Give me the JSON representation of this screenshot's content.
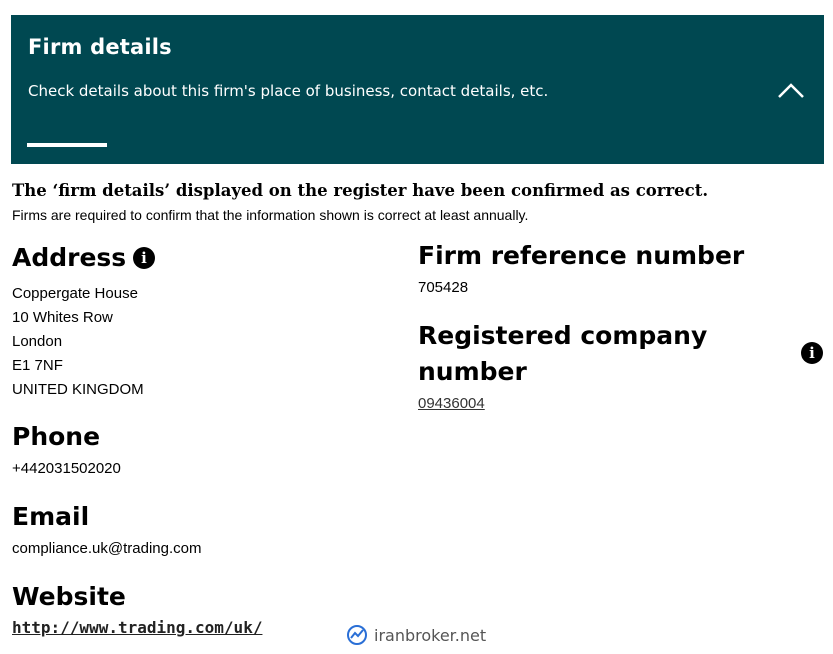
{
  "banner": {
    "title": "Firm details",
    "description": "Check details about this firm's place of business, contact details, etc.",
    "toggle_icon": "chevron-up-icon",
    "background_color": "#004851"
  },
  "confirmation": {
    "heading": "The ‘firm details’ displayed on the register have been confirmed as correct.",
    "subtext": "Firms are required to confirm that the information shown is correct at least annually."
  },
  "address": {
    "title": "Address",
    "info_icon": "info-icon",
    "lines": [
      "Coppergate House",
      "10 Whites Row",
      "London",
      "E1 7NF",
      "UNITED KINGDOM"
    ]
  },
  "phone": {
    "title": "Phone",
    "value": "+442031502020"
  },
  "email": {
    "title": "Email",
    "value": "compliance.uk@trading.com"
  },
  "website": {
    "title": "Website",
    "value": "http://www.trading.com/uk/"
  },
  "firm_reference": {
    "title": "Firm reference number",
    "value": "705428"
  },
  "registered_company": {
    "title_line1": "Registered company",
    "title_line2": "number",
    "value": "09436004",
    "info_icon": "info-icon"
  },
  "watermark": {
    "text": "iranbroker.net",
    "icon": "chart-trend-icon"
  }
}
